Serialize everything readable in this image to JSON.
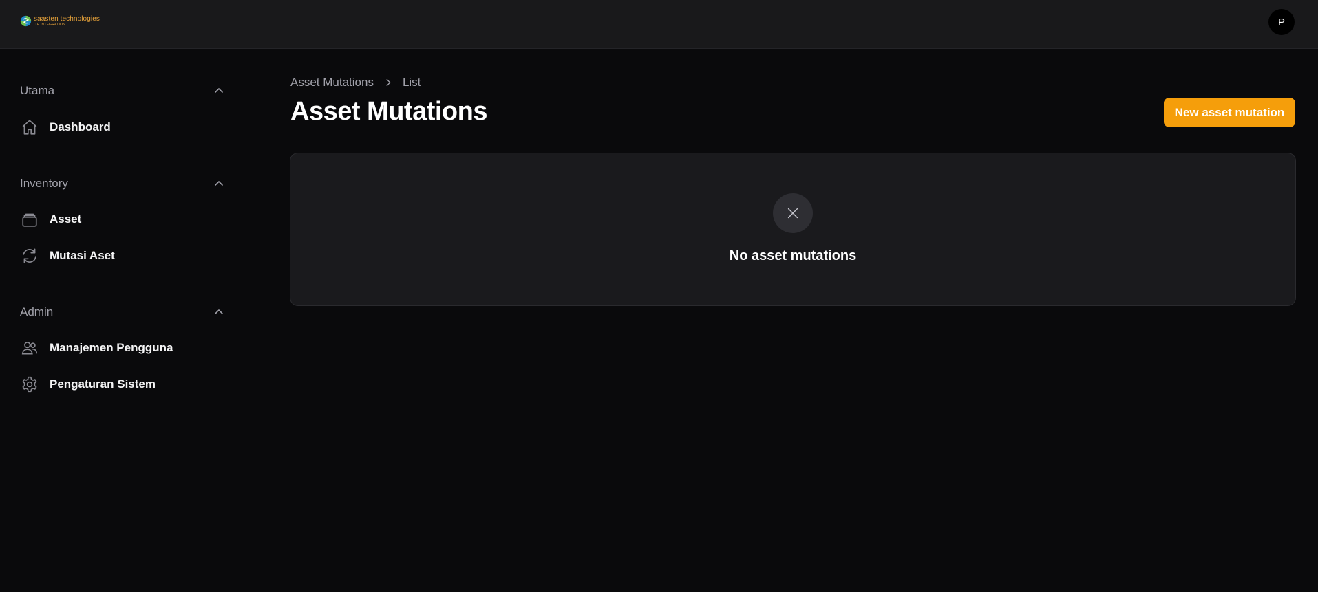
{
  "header": {
    "logo_name": "saasten technologies",
    "logo_tagline": "ITE INTEGRATION",
    "avatar_initial": "P"
  },
  "sidebar": {
    "groups": [
      {
        "label": "Utama",
        "items": [
          {
            "label": "Dashboard",
            "icon": "home-icon"
          }
        ]
      },
      {
        "label": "Inventory",
        "items": [
          {
            "label": "Asset",
            "icon": "archive-icon"
          },
          {
            "label": "Mutasi Aset",
            "icon": "refresh-icon"
          }
        ]
      },
      {
        "label": "Admin",
        "items": [
          {
            "label": "Manajemen Pengguna",
            "icon": "users-icon"
          },
          {
            "label": "Pengaturan Sistem",
            "icon": "gear-icon"
          }
        ]
      }
    ]
  },
  "main": {
    "breadcrumb": [
      "Asset Mutations",
      "List"
    ],
    "title": "Asset Mutations",
    "new_button_label": "New asset mutation",
    "empty_state": {
      "icon": "x-icon",
      "message": "No asset mutations"
    }
  },
  "colors": {
    "background": "#0a0a0c",
    "topbar": "#19191b",
    "accent": "#f59e0b",
    "card": "#1a1a1d",
    "muted_text": "#a1a1aa"
  }
}
